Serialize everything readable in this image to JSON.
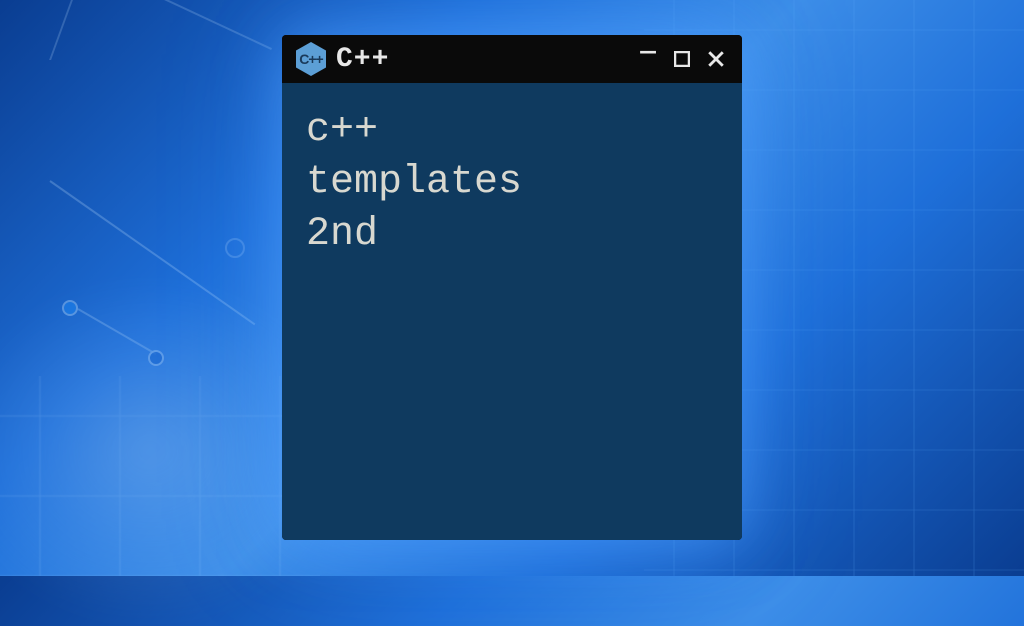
{
  "window": {
    "title": "C++",
    "icon_label": "C++"
  },
  "terminal": {
    "lines": [
      "c++",
      "templates",
      "2nd"
    ]
  },
  "colors": {
    "terminal_bg": "#0f3a5f",
    "titlebar_bg": "#0a0a0a",
    "text": "#d8d8d0",
    "icon_bg": "#5c9fd6"
  }
}
